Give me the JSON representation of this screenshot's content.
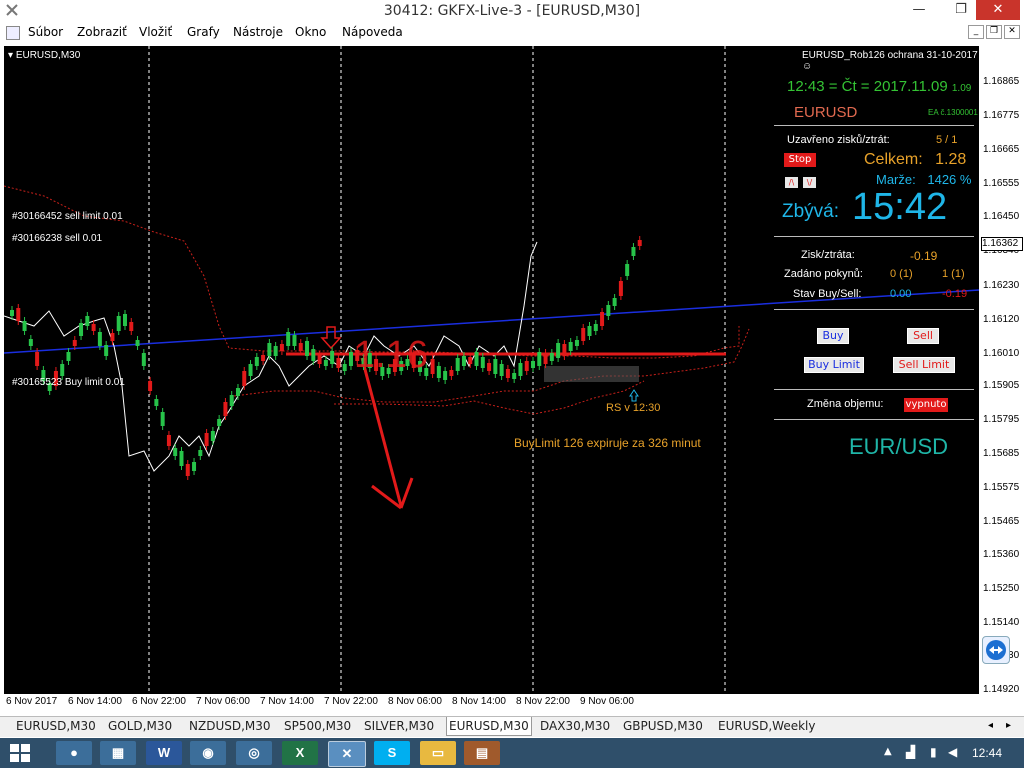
{
  "window": {
    "title": "30412: GKFX-Live-3 - [EURUSD,M30]",
    "minimize_glyph": "—",
    "restore_glyph": "❐",
    "close_glyph": "✕"
  },
  "menu": [
    "Súbor",
    "Zobraziť",
    "Vložiť",
    "Grafy",
    "Nástroje",
    "Okno",
    "Nápoveda"
  ],
  "chart": {
    "symbol_label": "EURUSD,M30",
    "header_right": "EURUSD_Rob126 ochrana 31-10-2017",
    "orders": [
      "#30166452 sell limit 0.01",
      "#30166238 sell 0.01",
      "#30165523 Buy limit 0.01"
    ],
    "big_text": "1.16",
    "rs_label": "RS v 12:30",
    "expiry_text": "BuyLimit 126 expiruje za 326 minut",
    "price_ticks": [
      "1.16865",
      "1.16775",
      "1.16665",
      "1.16555",
      "1.16450",
      "1.16362",
      "1.16340",
      "1.16230",
      "1.16120",
      "1.16010",
      "1.15905",
      "1.15795",
      "1.15685",
      "1.15575",
      "1.15465",
      "1.15360",
      "1.15250",
      "1.15140",
      "1.15030",
      "1.14920"
    ],
    "current_price": "1.16362",
    "time_ticks": [
      "6 Nov 2017",
      "6 Nov 14:00",
      "6 Nov 22:00",
      "7 Nov 06:00",
      "7 Nov 14:00",
      "7 Nov 22:00",
      "8 Nov 06:00",
      "8 Nov 14:00",
      "8 Nov 22:00",
      "9 Nov 06:00"
    ]
  },
  "panel": {
    "time_line": "12:43 = Čt = 2017.11.09",
    "time_suffix": "1.09",
    "symbol": "EURUSD",
    "ea_label": "EA č.1300001",
    "closed_label": "Uzavřeno zisků/ztrát:",
    "closed_value": "5 / 1",
    "stop_button": "Stop",
    "total_label": "Celkem:",
    "total_value": "1.28",
    "up_button": "/\\",
    "down_button": "\\/",
    "margin_label": "Marže:",
    "margin_value": "1426 %",
    "remaining_label": "Zbývá:",
    "remaining_value": "15:42",
    "profit_label": "Zisk/ztráta:",
    "profit_value": "-0.19",
    "orders_label": "Zadáno pokynů:",
    "orders_buy": "0 (1)",
    "orders_sell": "1 (1)",
    "status_label": "Stav Buy/Sell:",
    "status_buy": "0.00",
    "status_sell": "-0.19",
    "buy_button": "Buy",
    "sell_button": "Sell",
    "buy_limit_button": "Buy Limit",
    "sell_limit_button": "Sell Limit",
    "volume_label": "Změna objemu:",
    "volume_button": "vypnuto",
    "pair_label": "EUR/USD"
  },
  "tabs": [
    "EURUSD,M30",
    "GOLD,M30",
    "NZDUSD,M30",
    "SP500,M30",
    "SILVER,M30",
    "EURUSD,M30",
    "DAX30,M30",
    "GBPUSD,M30",
    "EURUSD,Weekly"
  ],
  "active_tab_index": 5,
  "taskbar": {
    "clock": "12:44",
    "apps": [
      "start",
      "paint",
      "calc",
      "word",
      "tool",
      "chrome",
      "excel",
      "metatrader",
      "skype",
      "explorer",
      "archive"
    ]
  },
  "colors": {
    "panel_green": "#34c334",
    "panel_orange": "#e8a22a",
    "panel_cyan": "#1fb6e8",
    "panel_red": "#e21a1a",
    "trend_blue": "#1a2ee0",
    "support_red": "#e21a1a"
  }
}
